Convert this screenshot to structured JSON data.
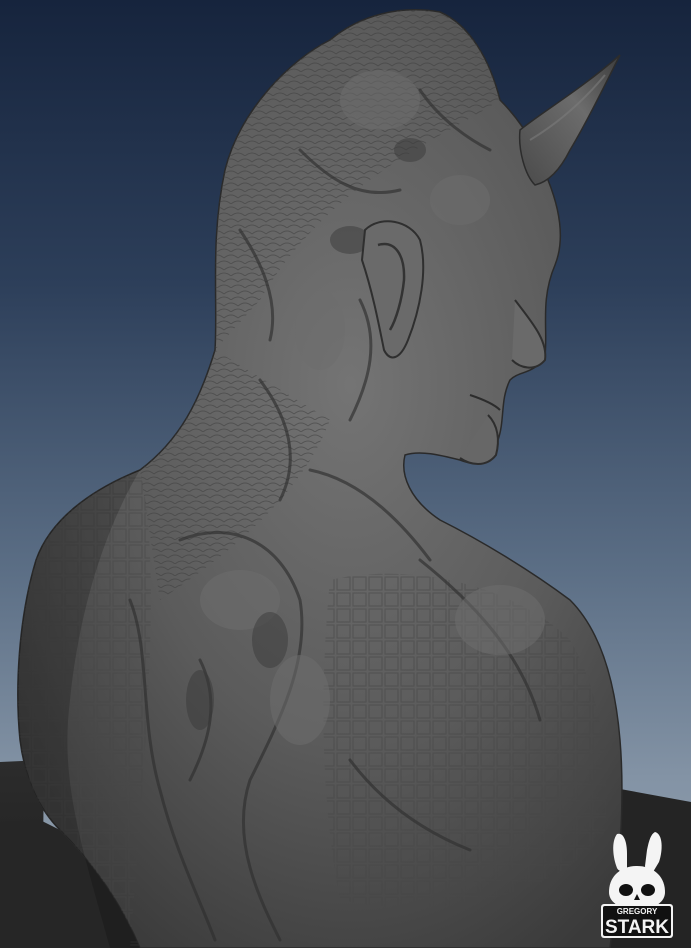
{
  "scene": {
    "subject": "sculpt-render",
    "colors": {
      "background_top": "#16243d",
      "background_bottom": "#98a4b1",
      "clay": "#5a5a5a",
      "pedestal": "#2a2a2a"
    }
  },
  "watermark": {
    "line1": "GREGORY",
    "line2": "STARK",
    "icon": "rabbit-skull-icon"
  }
}
